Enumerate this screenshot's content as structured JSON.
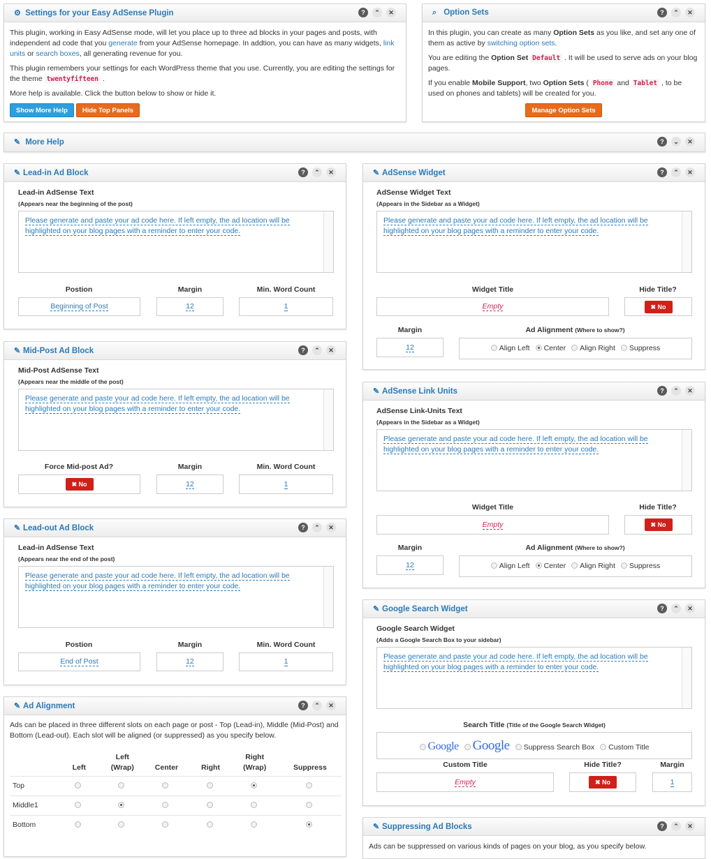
{
  "settings_panel": {
    "title": "Settings for your Easy AdSense Plugin",
    "p1_a": "This plugin, working in Easy AdSense mode, will let you place up to three ad blocks in your pages and posts, with independent ad code that you ",
    "p1_link1": "generate",
    "p1_b": " from your AdSense homepage. In addtion, you can have as many widgets, ",
    "p1_link2": "link units",
    "p1_c": " or ",
    "p1_link3": "search boxes",
    "p1_d": ", all generating revenue for you.",
    "p2_a": "This plugin remembers your settings for each WordPress theme that you use. Currently, you are editing the settings for the theme ",
    "p2_theme": "twentyfifteen",
    "p2_b": " .",
    "p3": "More help is available. Click the button below to show or hide it.",
    "btn_more_help": "Show More Help",
    "btn_hide_panels": "Hide Top Panels"
  },
  "option_sets_panel": {
    "title": "Option Sets",
    "p1_a": "In this plugin, you can create as many ",
    "p1_b": "Option Sets",
    "p1_c": " as you like, and set any one of them as active by ",
    "p1_link": "switching option sets",
    "p1_d": ".",
    "p2_a": "You are editing the ",
    "p2_b": "Option Set",
    "p2_code": "Default",
    "p2_c": " . It will be used to serve ads on your blog pages.",
    "p3_a": "If you enable ",
    "p3_b": "Mobile Support",
    "p3_c": ", two ",
    "p3_d": "Option Sets",
    "p3_e": " ( ",
    "p3_code1": "Phone",
    "p3_f": " and ",
    "p3_code2": "Tablet",
    "p3_g": " , to be used on phones and tablets) will be created for you.",
    "btn_manage": "Manage Option Sets"
  },
  "more_help": {
    "title": "More Help"
  },
  "placeholder_text": "Please generate and paste your ad code here. If left empty, the ad location will be highlighted on your blog pages with a reminder to enter your code.",
  "leadin": {
    "title": "Lead-in Ad Block",
    "label": "Lead-in AdSense Text",
    "sub": "(Appears near the beginning of the post)",
    "col1": "Postion",
    "col2": "Margin",
    "col3": "Min. Word Count",
    "position": "Beginning of Post",
    "margin": "12",
    "min_words": "1"
  },
  "midpost": {
    "title": "Mid-Post Ad Block",
    "label": "Mid-Post AdSense Text",
    "sub": "(Appears near the middle of the post)",
    "col1": "Force Mid-post Ad?",
    "col2": "Margin",
    "col3": "Min. Word Count",
    "force": "No",
    "margin": "12",
    "min_words": "1"
  },
  "leadout": {
    "title": "Lead-out Ad Block",
    "label": "Lead-in AdSense Text",
    "sub": "(Appears near the end of the post)",
    "col1": "Postion",
    "col2": "Margin",
    "col3": "Min. Word Count",
    "position": "End of Post",
    "margin": "12",
    "min_words": "1"
  },
  "ad_alignment": {
    "title": "Ad Alignment",
    "desc": "Ads can be placed in three different slots on each page or post - Top (Lead-in), Middle (Mid-Post) and Bottom (Lead-out). Each slot will be aligned (or suppressed) as you specify below.",
    "columns": [
      "Left",
      "Left\n(Wrap)",
      "Center",
      "Right",
      "Right\n(Wrap)",
      "Suppress"
    ],
    "col_left": "Left",
    "col_leftwrap_1": "Left",
    "col_leftwrap_2": "(Wrap)",
    "col_center": "Center",
    "col_right": "Right",
    "col_rightwrap_1": "Right",
    "col_rightwrap_2": "(Wrap)",
    "col_suppress": "Suppress",
    "rows": [
      {
        "name": "Top",
        "selected": 4
      },
      {
        "name": "Middle1",
        "selected": 1
      },
      {
        "name": "Bottom",
        "selected": 5
      }
    ]
  },
  "adsense_widget": {
    "title": "AdSense Widget",
    "label": "AdSense Widget Text",
    "sub": "(Appears in the Sidebar as a Widget)",
    "widget_title_label": "Widget Title",
    "hide_title_label": "Hide Title?",
    "widget_title_value": "Empty",
    "hide_title_value": "No",
    "margin_label": "Margin",
    "margin": "12",
    "align_label": "Ad Alignment",
    "align_sub": "(Where to show?)",
    "options": [
      "Align Left",
      "Center",
      "Align Right",
      "Suppress"
    ],
    "selected": "Center"
  },
  "link_units": {
    "title": "AdSense Link Units",
    "label": "AdSense Link-Units Text",
    "sub": "(Appears in the Sidebar as a Widget)",
    "widget_title_label": "Widget Title",
    "hide_title_label": "Hide Title?",
    "widget_title_value": "Empty",
    "hide_title_value": "No",
    "margin_label": "Margin",
    "margin": "12",
    "align_label": "Ad Alignment",
    "align_sub": "(Where to show?)",
    "options": [
      "Align Left",
      "Center",
      "Align Right",
      "Suppress"
    ],
    "selected": "Center"
  },
  "google_search": {
    "title": "Google Search Widget",
    "label": "Google Search Widget",
    "sub": "(Adds a Google Search Box to your sidebar)",
    "search_title_label": "Search Title",
    "search_title_sub": "(Title of the Google Search Widget)",
    "logo_text": "Google",
    "opt_suppress": "Suppress Search Box",
    "opt_custom": "Custom Title",
    "custom_title_label": "Custom Title",
    "hide_title_label": "Hide Title?",
    "margin_label": "Margin",
    "custom_title_value": "Empty",
    "hide_title_value": "No",
    "margin": "1"
  },
  "suppressing": {
    "title": "Suppressing Ad Blocks",
    "desc": "Ads can be suppressed on various kinds of pages on your blog, as you specify below."
  },
  "icons": {
    "gear": "⚙",
    "search": "⌕",
    "edit": "✎",
    "help": "?",
    "up": "⌃",
    "down": "⌄",
    "close": "✕",
    "x": "✖"
  },
  "colors": {
    "accent": "#2a7ab8",
    "blue_button": "#2d9fde",
    "orange_button": "#e86b1c",
    "no_button": "#d0201a",
    "code_text": "#c7254e"
  }
}
